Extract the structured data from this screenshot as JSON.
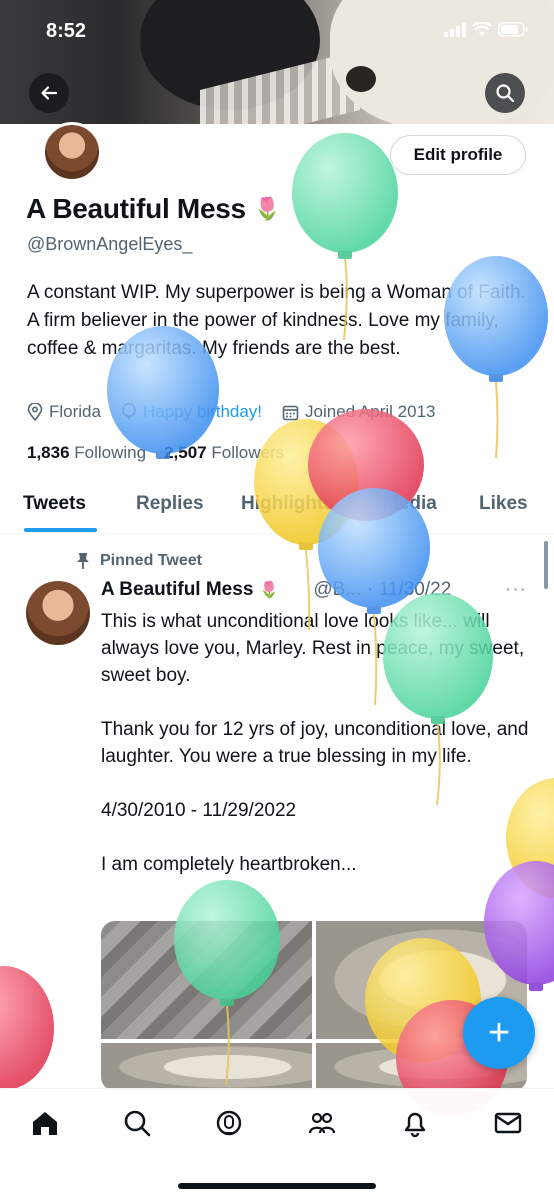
{
  "status_bar": {
    "time": "8:52"
  },
  "header": {
    "back_icon": "arrow-left-icon",
    "search_icon": "search-icon"
  },
  "profile": {
    "edit_button": "Edit profile",
    "name": "A Beautiful Mess",
    "name_emoji": "🌷",
    "handle": "@BrownAngelEyes_",
    "bio": "A constant WIP. My superpower is being a Woman of Faith. A firm believer in the power of kindness. Love my family, coffee & margaritas. My friends are the best.",
    "location": "Florida",
    "birthday": "Happy birthday!",
    "joined": "Joined April 2013",
    "following_count": "1,836",
    "following_label": "Following",
    "followers_count": "2,507",
    "followers_label": "Followers"
  },
  "tabs": [
    "Tweets",
    "Replies",
    "Highlights",
    "Media",
    "Likes"
  ],
  "tweet": {
    "pinned_label": "Pinned Tweet",
    "author": "A Beautiful Mess",
    "author_emoji": "🌷",
    "handle": "@B...",
    "date": "· 11/30/22",
    "more": "···",
    "paragraphs": [
      "This is what unconditional love looks like... will always love you, Marley. Rest in peace, my sweet, sweet boy.",
      "Thank you for 12 yrs of joy, unconditional love, and laughter. You were a true blessing in my life.",
      "4/30/2010 - 11/29/2022",
      "I am completely heartbroken..."
    ]
  },
  "fab": {
    "label": "+"
  },
  "bottom_nav": [
    "home-icon",
    "search-icon",
    "spaces-icon",
    "communities-icon",
    "notifications-icon",
    "messages-icon"
  ],
  "colors": {
    "accent": "#1d9bf0",
    "text": "#0f1419",
    "secondary": "#536471"
  }
}
